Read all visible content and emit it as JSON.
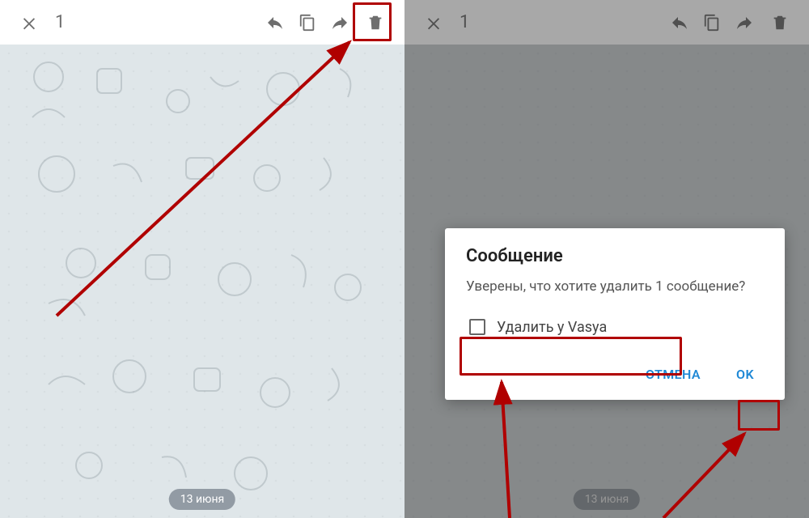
{
  "left": {
    "selection_count": "1",
    "date_pill": "13 июня"
  },
  "right": {
    "selection_count": "1",
    "date_pill": "13 июня",
    "dialog": {
      "title": "Сообщение",
      "body": "Уверены, что хотите удалить 1 сообщение?",
      "delete_for_label": "Удалить у Vasya",
      "cancel_label": "ОТМЕНА",
      "ok_label": "OK"
    }
  },
  "icons": {
    "close": "close-icon",
    "reply": "reply-icon",
    "copy": "copy-icon",
    "forward": "forward-icon",
    "delete": "delete-icon"
  },
  "annotations": {
    "highlight_color": "#b00000"
  }
}
